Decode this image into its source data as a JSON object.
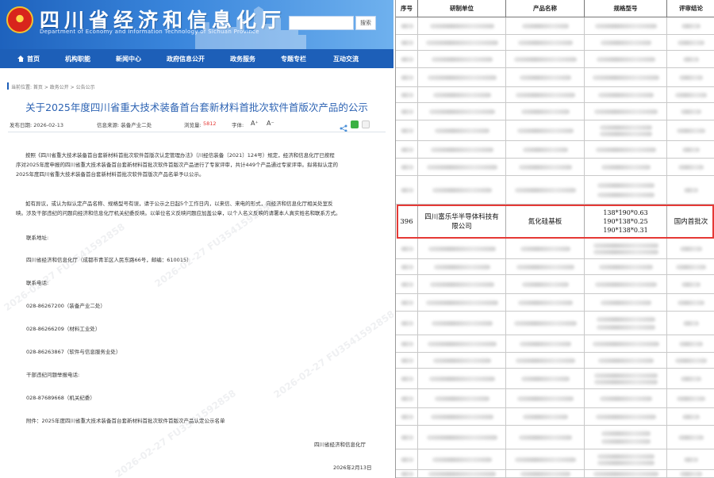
{
  "site": {
    "title": "四川省经济和信息化厅",
    "subtitle": "Department of Economy and Information Technology of Sichuan Province",
    "search_button": "搜索"
  },
  "nav": [
    {
      "label": "首页",
      "icon": "home-icon"
    },
    {
      "label": "机构职能"
    },
    {
      "label": "新闻中心"
    },
    {
      "label": "政府信息公开"
    },
    {
      "label": "政务服务"
    },
    {
      "label": "专题专栏"
    },
    {
      "label": "互动交流"
    }
  ],
  "breadcrumb": "当前位置: 首页 > 政务公开 > 公告公示",
  "article": {
    "title": "关于2025年度四川省重大技术装备首台套新材料首批次软件首版次产品的公示",
    "publish_date": "发布日期: 2026-02-13",
    "source": "信息来源: 装备产业二处",
    "views_label": "浏览量:",
    "views": "5812",
    "font_label": "字体:",
    "font_larger": "A⁺",
    "font_smaller": "A⁻",
    "para1_line1": "按照《四川省重大技术装备首台套新材料首批次软件首版次认定管理办法》（川经信装备〔2021〕124号）规定，经济和信息化厅已按程",
    "para1_line2": "序对2025年度申报的四川省重大技术装备首台套新材料首批次软件首版次产品进行了专家评审，共计449个产品通过专家评审。拟将拟认定的",
    "para1_line3": "2025年度四川省重大技术装备首台套新材料首批次软件首版次产品名单予以公示。",
    "para2_line1": "如有异议，或认为拟认定产品名称、规格型号有误，请于公示之日起5个工作日内，以来信、来电的形式，向经济和信息化厅相关处室反",
    "para2_line2": "映。涉及干部违纪的问题向经济和信息化厅机关纪委反映。以单位名义反映问题应加盖公章，以个人名义反映的请署本人真实姓名和联系方式。",
    "address_label": "联系地址:",
    "address": "四川省经济和信息化厅（成都市青羊区人民东路66号，邮编：610015）",
    "phone_label": "联系电话:",
    "phone1": "028-86267200（装备产业二处）",
    "phone2": "028-86266209（材料工业处）",
    "phone3": "028-86263867（软件与信息服务业处）",
    "discipline_label": "干部违纪问题举报电话:",
    "discipline_phone": "028-87689668（机关纪委）",
    "attachment": "附件：2025年度四川省重大技术装备首台套新材料首批次软件首版次产品认定公示名单",
    "sign_org": "四川省经济和信息化厅",
    "sign_date": "2026年2月13日"
  },
  "watermark": "2026-02-27 FU3541592858",
  "table": {
    "headers": [
      "序号",
      "研制单位",
      "产品名称",
      "规格型号",
      "评审结论"
    ],
    "highlighted_row": {
      "no": "396",
      "company_line1": "四川富乐华半导体科技有",
      "company_line2": "限公司",
      "product": "氮化硅基板",
      "spec": [
        "138*190*0.63",
        "190*138*0.25",
        "190*138*0.31"
      ],
      "conclusion": "国内首批次"
    }
  },
  "colors": {
    "header_blue": "#1e62bd",
    "nav_blue": "#1d5fb8",
    "title_blue": "#2d63b3",
    "views_red": "#e53935",
    "highlight_red": "#e53935"
  }
}
